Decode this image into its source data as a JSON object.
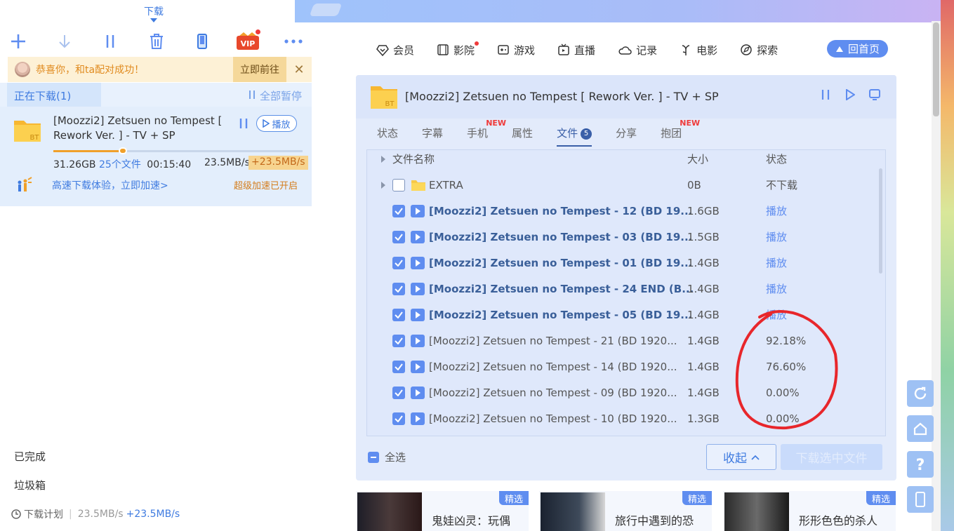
{
  "left": {
    "tab_label": "下载",
    "notice": {
      "message": "恭喜你，和ta配对成功！",
      "go_label": "立即前往"
    },
    "downloading_tab": "正在下载(1)",
    "pause_all": "全部暂停",
    "task": {
      "name": "[Moozzi2] Zetsuen no Tempest [ Rework Ver. ] - TV + SP",
      "play_label": "播放",
      "progress": 0.28,
      "size": "31.26GB",
      "files": "25个文件",
      "time": "00:15:40",
      "speed": "23.5MB/s",
      "boost": "+23.5MB/s",
      "promo": "高速下载体验，立即加速>",
      "promo_right": "超级加速已开启"
    },
    "completed": "已完成",
    "trash": "垃圾箱",
    "plan": {
      "label": "下载计划",
      "speed": "23.5MB/s",
      "boost": "+23.5MB/s"
    }
  },
  "nav": {
    "items": [
      {
        "label": "会员",
        "icon": "diamond-icon"
      },
      {
        "label": "影院",
        "icon": "film-icon"
      },
      {
        "label": "游戏",
        "icon": "gamepad-icon"
      },
      {
        "label": "直播",
        "icon": "tv-icon"
      },
      {
        "label": "记录",
        "icon": "cloud-icon"
      },
      {
        "label": "电影",
        "icon": "flower-icon"
      },
      {
        "label": "探索",
        "icon": "explore-icon"
      }
    ],
    "home_label": "回首页"
  },
  "card": {
    "title": "[Moozzi2] Zetsuen no Tempest [ Rework Ver. ] - TV + SP",
    "tabs": [
      "状态",
      "字幕",
      "手机",
      "属性",
      "文件",
      "分享",
      "抱团"
    ],
    "new_tag": "NEW",
    "files_count": "5",
    "columns": {
      "name": "文件名称",
      "size": "大小",
      "status": "状态"
    },
    "rows": [
      {
        "name": "EXTRA",
        "size": "0B",
        "status": "不下载"
      },
      {
        "name": "[Moozzi2] Zetsuen no Tempest - 12 (BD 19...",
        "size": "1.6GB",
        "status": "播放"
      },
      {
        "name": "[Moozzi2] Zetsuen no Tempest - 03 (BD 19...",
        "size": "1.5GB",
        "status": "播放"
      },
      {
        "name": "[Moozzi2] Zetsuen no Tempest - 01 (BD 19...",
        "size": "1.4GB",
        "status": "播放"
      },
      {
        "name": "[Moozzi2] Zetsuen no Tempest - 24 END (B...",
        "size": "1.4GB",
        "status": "播放"
      },
      {
        "name": "[Moozzi2] Zetsuen no Tempest - 05 (BD 19...",
        "size": "1.4GB",
        "status": "播放"
      },
      {
        "name": "[Moozzi2] Zetsuen no Tempest - 21 (BD 1920...",
        "size": "1.4GB",
        "status": "92.18%"
      },
      {
        "name": "[Moozzi2] Zetsuen no Tempest - 14 (BD 1920...",
        "size": "1.4GB",
        "status": "76.60%"
      },
      {
        "name": "[Moozzi2] Zetsuen no Tempest - 09 (BD 1920...",
        "size": "1.4GB",
        "status": "0.00%"
      },
      {
        "name": "[Moozzi2] Zetsuen no Tempest - 10 (BD 1920...",
        "size": "1.3GB",
        "status": "0.00%"
      }
    ],
    "select_all": "全选",
    "collapse": "收起",
    "download_selected": "下载选中文件"
  },
  "recs": [
    {
      "badge": "精选",
      "title": "鬼娃凶灵：玩偶"
    },
    {
      "badge": "精选",
      "title": "旅行中遇到的恐"
    },
    {
      "badge": "精选",
      "title": "形形色色的杀人"
    }
  ],
  "colors": {
    "accent": "#5f8df0",
    "annotation": "#e8262b",
    "notice_bg": "#fdf1d6"
  }
}
